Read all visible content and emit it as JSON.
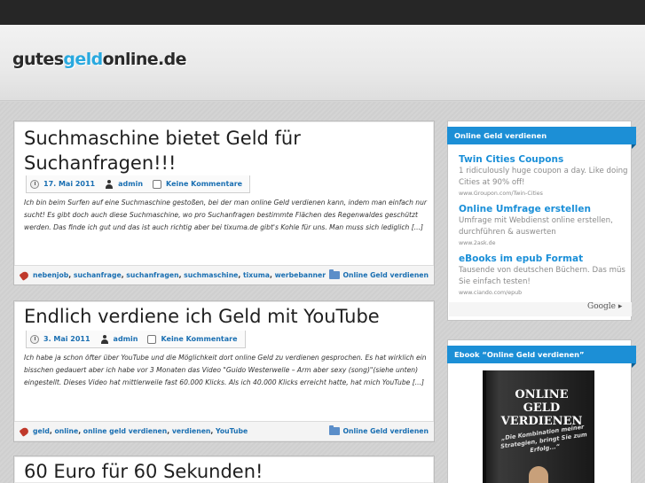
{
  "site": {
    "logo_pre": "gutes",
    "logo_accent": "geld",
    "logo_post": "online.de",
    "accent_color": "#29a9df"
  },
  "posts": [
    {
      "title_line1": "Suchmaschine bietet Geld für",
      "title_line2": "Suchanfragen!!!",
      "date": "17. Mai 2011",
      "author": "admin",
      "comments": "Keine Kommentare",
      "excerpt": "Ich bin beim Surfen auf eine Suchmaschine gestoßen, bei der man online Geld verdienen kann, indem man einfach nur sucht! Es gibt doch auch diese Suchmaschine, wo pro Suchanfragen bestimmte Flächen des Regenwaldes geschützt werden. Das finde ich gut und das ist auch richtig aber bei tixuma.de gibt's Kohle für uns. Man muss sich lediglich [...]",
      "tags": [
        "nebenjob",
        "suchanfrage",
        "suchanfragen",
        "suchmaschine",
        "tixuma",
        "werbebanner"
      ],
      "category": "Online Geld verdienen"
    },
    {
      "title_line1": "Endlich verdiene ich Geld mit YouTube",
      "date": "3. Mai 2011",
      "author": "admin",
      "comments": "Keine Kommentare",
      "excerpt": "Ich habe ja schon öfter über YouTube und die Möglichkeit dort online Geld zu verdienen gesprochen. Es hat wirklich ein bisschen gedauert aber ich habe vor 3 Monaten das Video \"Guido Westerwelle – Arm aber sexy (song)\"(siehe unten) eingestellt. Dieses Video hat mittlerweile fast 60.000 Klicks. Als ich 40.000 Klicks erreicht hatte, hat mich YouTube [...]",
      "tags": [
        "geld",
        "online",
        "online geld verdienen",
        "verdienen",
        "YouTube"
      ],
      "category": "Online Geld verdienen"
    },
    {
      "title_line1": "60 Euro für 60 Sekunden!"
    }
  ],
  "sidebar": {
    "ads_title": "Online Geld verdienen",
    "ads": [
      {
        "title": "Twin Cities Coupons",
        "text1": "1 ridiculously huge coupon a day. Like doing",
        "text2": "Cities at 90% off!",
        "url": "www.Groupon.com/Twin-Cities"
      },
      {
        "title": "Online Umfrage erstellen",
        "text1": "Umfrage mit Webdienst online erstellen,",
        "text2": "durchführen & auswerten",
        "url": "www.2ask.de"
      },
      {
        "title": "eBooks im epub Format",
        "text1": "Tausende von deutschen Büchern. Das müs",
        "text2": "Sie einfach testen!",
        "url": "www.ciando.com/epub"
      }
    ],
    "ad_choices": "Google",
    "ebook_title": "Ebook “Online Geld verdienen”",
    "book_cover_line1": "ONLINE GELD",
    "book_cover_line2": "VERDIENEN",
    "book_subtitle": "„Die Kombination meiner Strategien, bringt Sie zum Erfolg...“"
  }
}
